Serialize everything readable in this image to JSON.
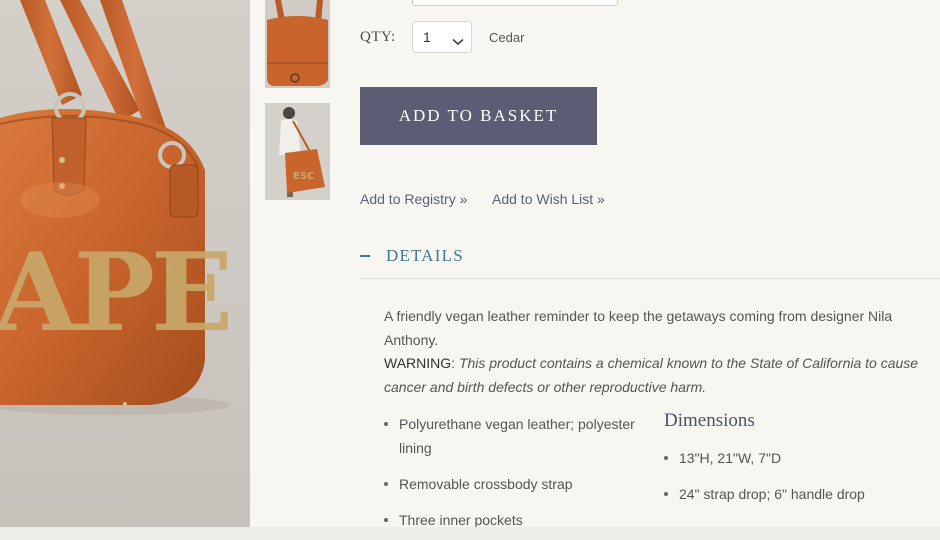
{
  "product": {
    "qty_label": "QTY:",
    "qty_value": "1",
    "color_name": "Cedar",
    "add_button_label": "ADD TO BASKET",
    "links": {
      "registry": "Add to Registry »",
      "wishlist": "Add to Wish List »"
    }
  },
  "details": {
    "toggle_symbol": "–",
    "title": "DETAILS",
    "description": "A friendly vegan leather reminder to keep the getaways coming from designer Nila Anthony.",
    "warning_label": "WARNING",
    "warning_text": "This product contains a chemical known to the State of California to cause cancer and birth defects or other reproductive harm.",
    "features": [
      "Polyurethane vegan leather; polyester lining",
      "Removable crossbody strap",
      "Three inner pockets"
    ],
    "dimensions_title": "Dimensions",
    "dimensions": [
      "13\"H, 21\"W, 7\"D",
      "24\" strap drop; 6\" handle drop"
    ]
  },
  "image_text": {
    "bag_lettering": "APE"
  },
  "colors": {
    "button": "#5a5d73",
    "details_accent": "#3f7890",
    "bag_leather": "#c8642c",
    "background": "#f7f6f1"
  },
  "icons": {
    "qty_dropdown": "chevron-down-icon"
  }
}
